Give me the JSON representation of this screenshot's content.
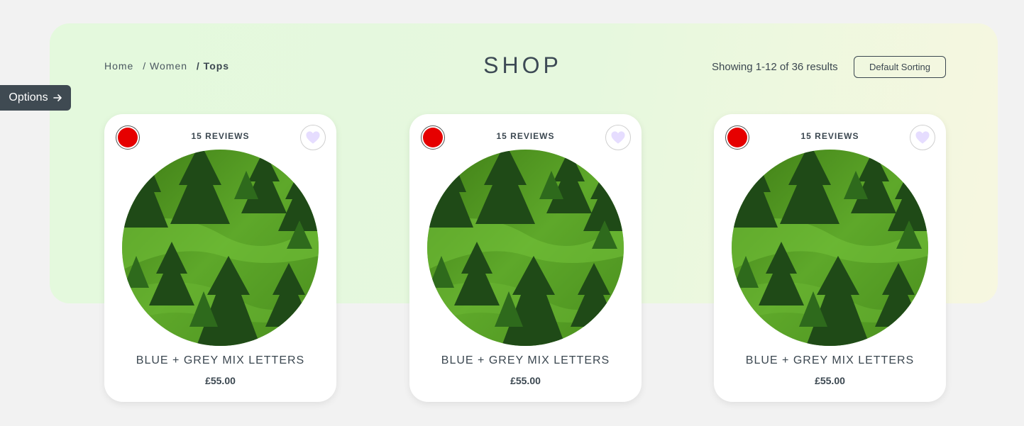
{
  "breadcrumb": {
    "items": [
      "Home",
      "/ Women",
      "/ Tops"
    ]
  },
  "header": {
    "title": "SHOP",
    "results_text": "Showing 1-12 of 36 results",
    "sort_label": "Default Sorting"
  },
  "options": {
    "label": "Options",
    "icon": "arrow-right-icon"
  },
  "colors": {
    "swatch": "#e60000",
    "wishlist_heart": "#e6ddff",
    "options_bg": "#3f4a52"
  },
  "products": [
    {
      "reviews": "15 REVIEWS",
      "name": "BLUE + GREY MIX LETTERS",
      "price": "£55.00"
    },
    {
      "reviews": "15 REVIEWS",
      "name": "BLUE + GREY MIX LETTERS",
      "price": "£55.00"
    },
    {
      "reviews": "15 REVIEWS",
      "name": "BLUE + GREY MIX LETTERS",
      "price": "£55.00"
    }
  ]
}
